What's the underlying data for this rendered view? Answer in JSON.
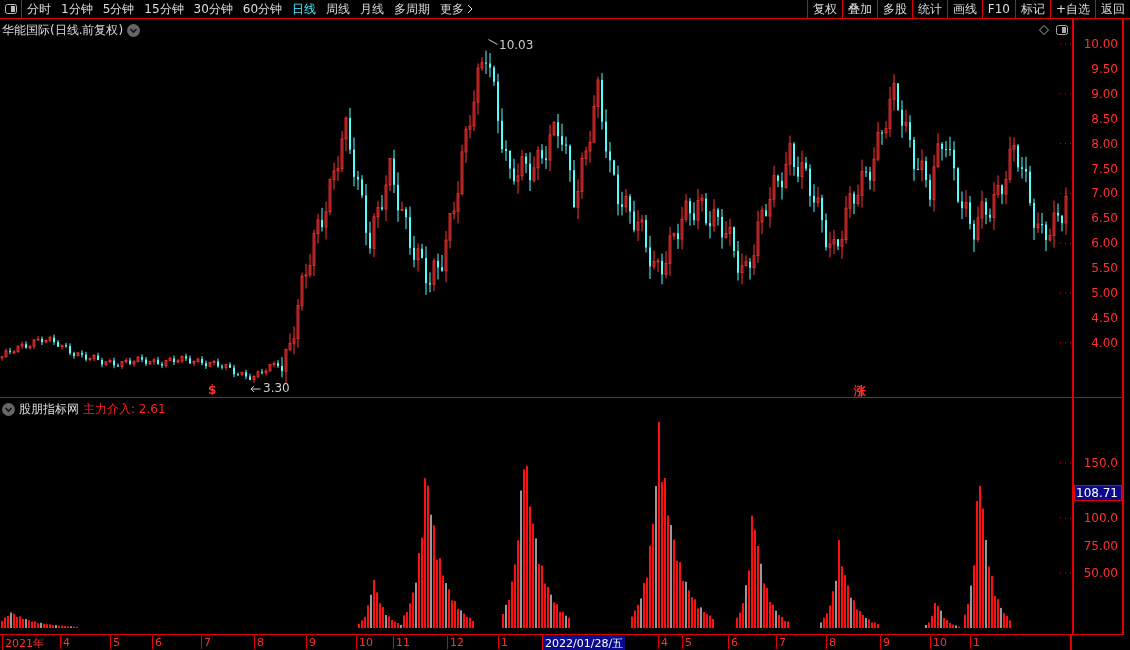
{
  "toolbar": {
    "periods": [
      {
        "label": "分时",
        "selected": false
      },
      {
        "label": "1分钟",
        "selected": false
      },
      {
        "label": "5分钟",
        "selected": false
      },
      {
        "label": "15分钟",
        "selected": false
      },
      {
        "label": "30分钟",
        "selected": false
      },
      {
        "label": "60分钟",
        "selected": false
      },
      {
        "label": "日线",
        "selected": true
      },
      {
        "label": "周线",
        "selected": false
      },
      {
        "label": "月线",
        "selected": false
      },
      {
        "label": "多周期",
        "selected": false
      },
      {
        "label": "更多",
        "selected": false
      }
    ],
    "actions": [
      "复权",
      "叠加",
      "多股",
      "统计",
      "画线",
      "F10",
      "标记",
      "+自选",
      "返回"
    ]
  },
  "main_panel": {
    "title": "华能国际(日线.前复权)",
    "high_label": "10.03",
    "low_label": "3.30",
    "markers": [
      {
        "text": "$"
      },
      {
        "text": "涨"
      }
    ],
    "y_axis": [
      "10.00",
      "9.50",
      "9.00",
      "8.50",
      "8.00",
      "7.50",
      "7.00",
      "6.50",
      "6.00",
      "5.50",
      "5.00",
      "4.50",
      "4.00"
    ]
  },
  "indicator_panel": {
    "title": "股朋指标网",
    "reading": "主力介入: 2.61",
    "y_axis": [
      "150.0",
      "100.0",
      "75.00",
      "50.00"
    ],
    "current_value": "108.71"
  },
  "x_axis": [
    {
      "label": "2021年",
      "selected": false
    },
    {
      "label": "4",
      "selected": false
    },
    {
      "label": "5",
      "selected": false
    },
    {
      "label": "6",
      "selected": false
    },
    {
      "label": "7",
      "selected": false
    },
    {
      "label": "8",
      "selected": false
    },
    {
      "label": "9",
      "selected": false
    },
    {
      "label": "10",
      "selected": false
    },
    {
      "label": "11",
      "selected": false
    },
    {
      "label": "12",
      "selected": false
    },
    {
      "label": "1",
      "selected": false
    },
    {
      "label": "2022/01/28/五",
      "selected": true
    },
    {
      "label": "4",
      "selected": false
    },
    {
      "label": "5",
      "selected": false
    },
    {
      "label": "6",
      "selected": false
    },
    {
      "label": "7",
      "selected": false
    },
    {
      "label": "8",
      "selected": false
    },
    {
      "label": "9",
      "selected": false
    },
    {
      "label": "10",
      "selected": false
    },
    {
      "label": "1",
      "selected": false
    }
  ]
}
